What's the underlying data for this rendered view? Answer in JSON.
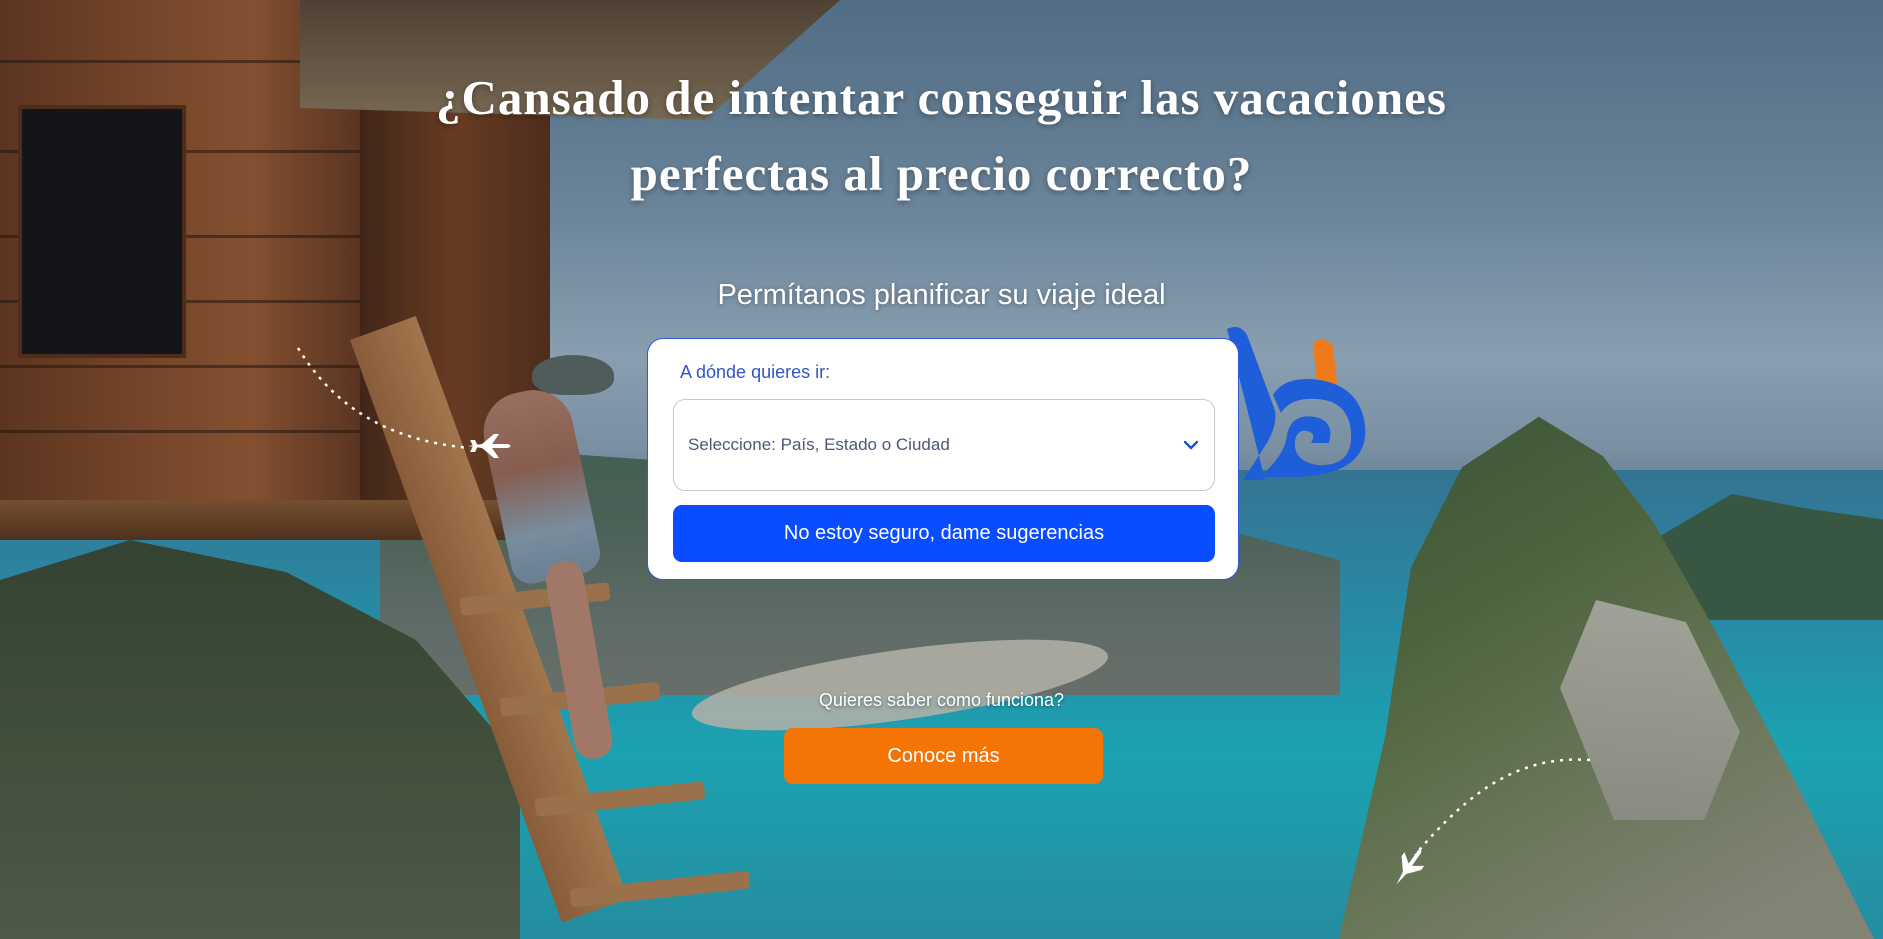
{
  "hero": {
    "headline_line1": "¿Cansado de intentar conseguir las vacaciones",
    "headline_line2": "perfectas al precio correcto?",
    "subheadline": "Permítanos planificar su viaje ideal"
  },
  "search": {
    "label": "A dónde quieres ir:",
    "select_placeholder": "Seleccione: País, Estado o Ciudad",
    "suggest_button": "No estoy seguro, dame sugerencias"
  },
  "cta": {
    "question": "Quieres saber como funciona?",
    "button": "Conoce más"
  },
  "icons": {
    "dropdown": "chevron-down-icon",
    "plane_top": "airplane-icon",
    "plane_bottom": "airplane-icon"
  },
  "colors": {
    "primary_blue": "#0a4cff",
    "label_blue": "#2f55c9",
    "orange": "#f47405",
    "logo_blue": "#1e5ed8",
    "logo_orange": "#f07a1a"
  }
}
